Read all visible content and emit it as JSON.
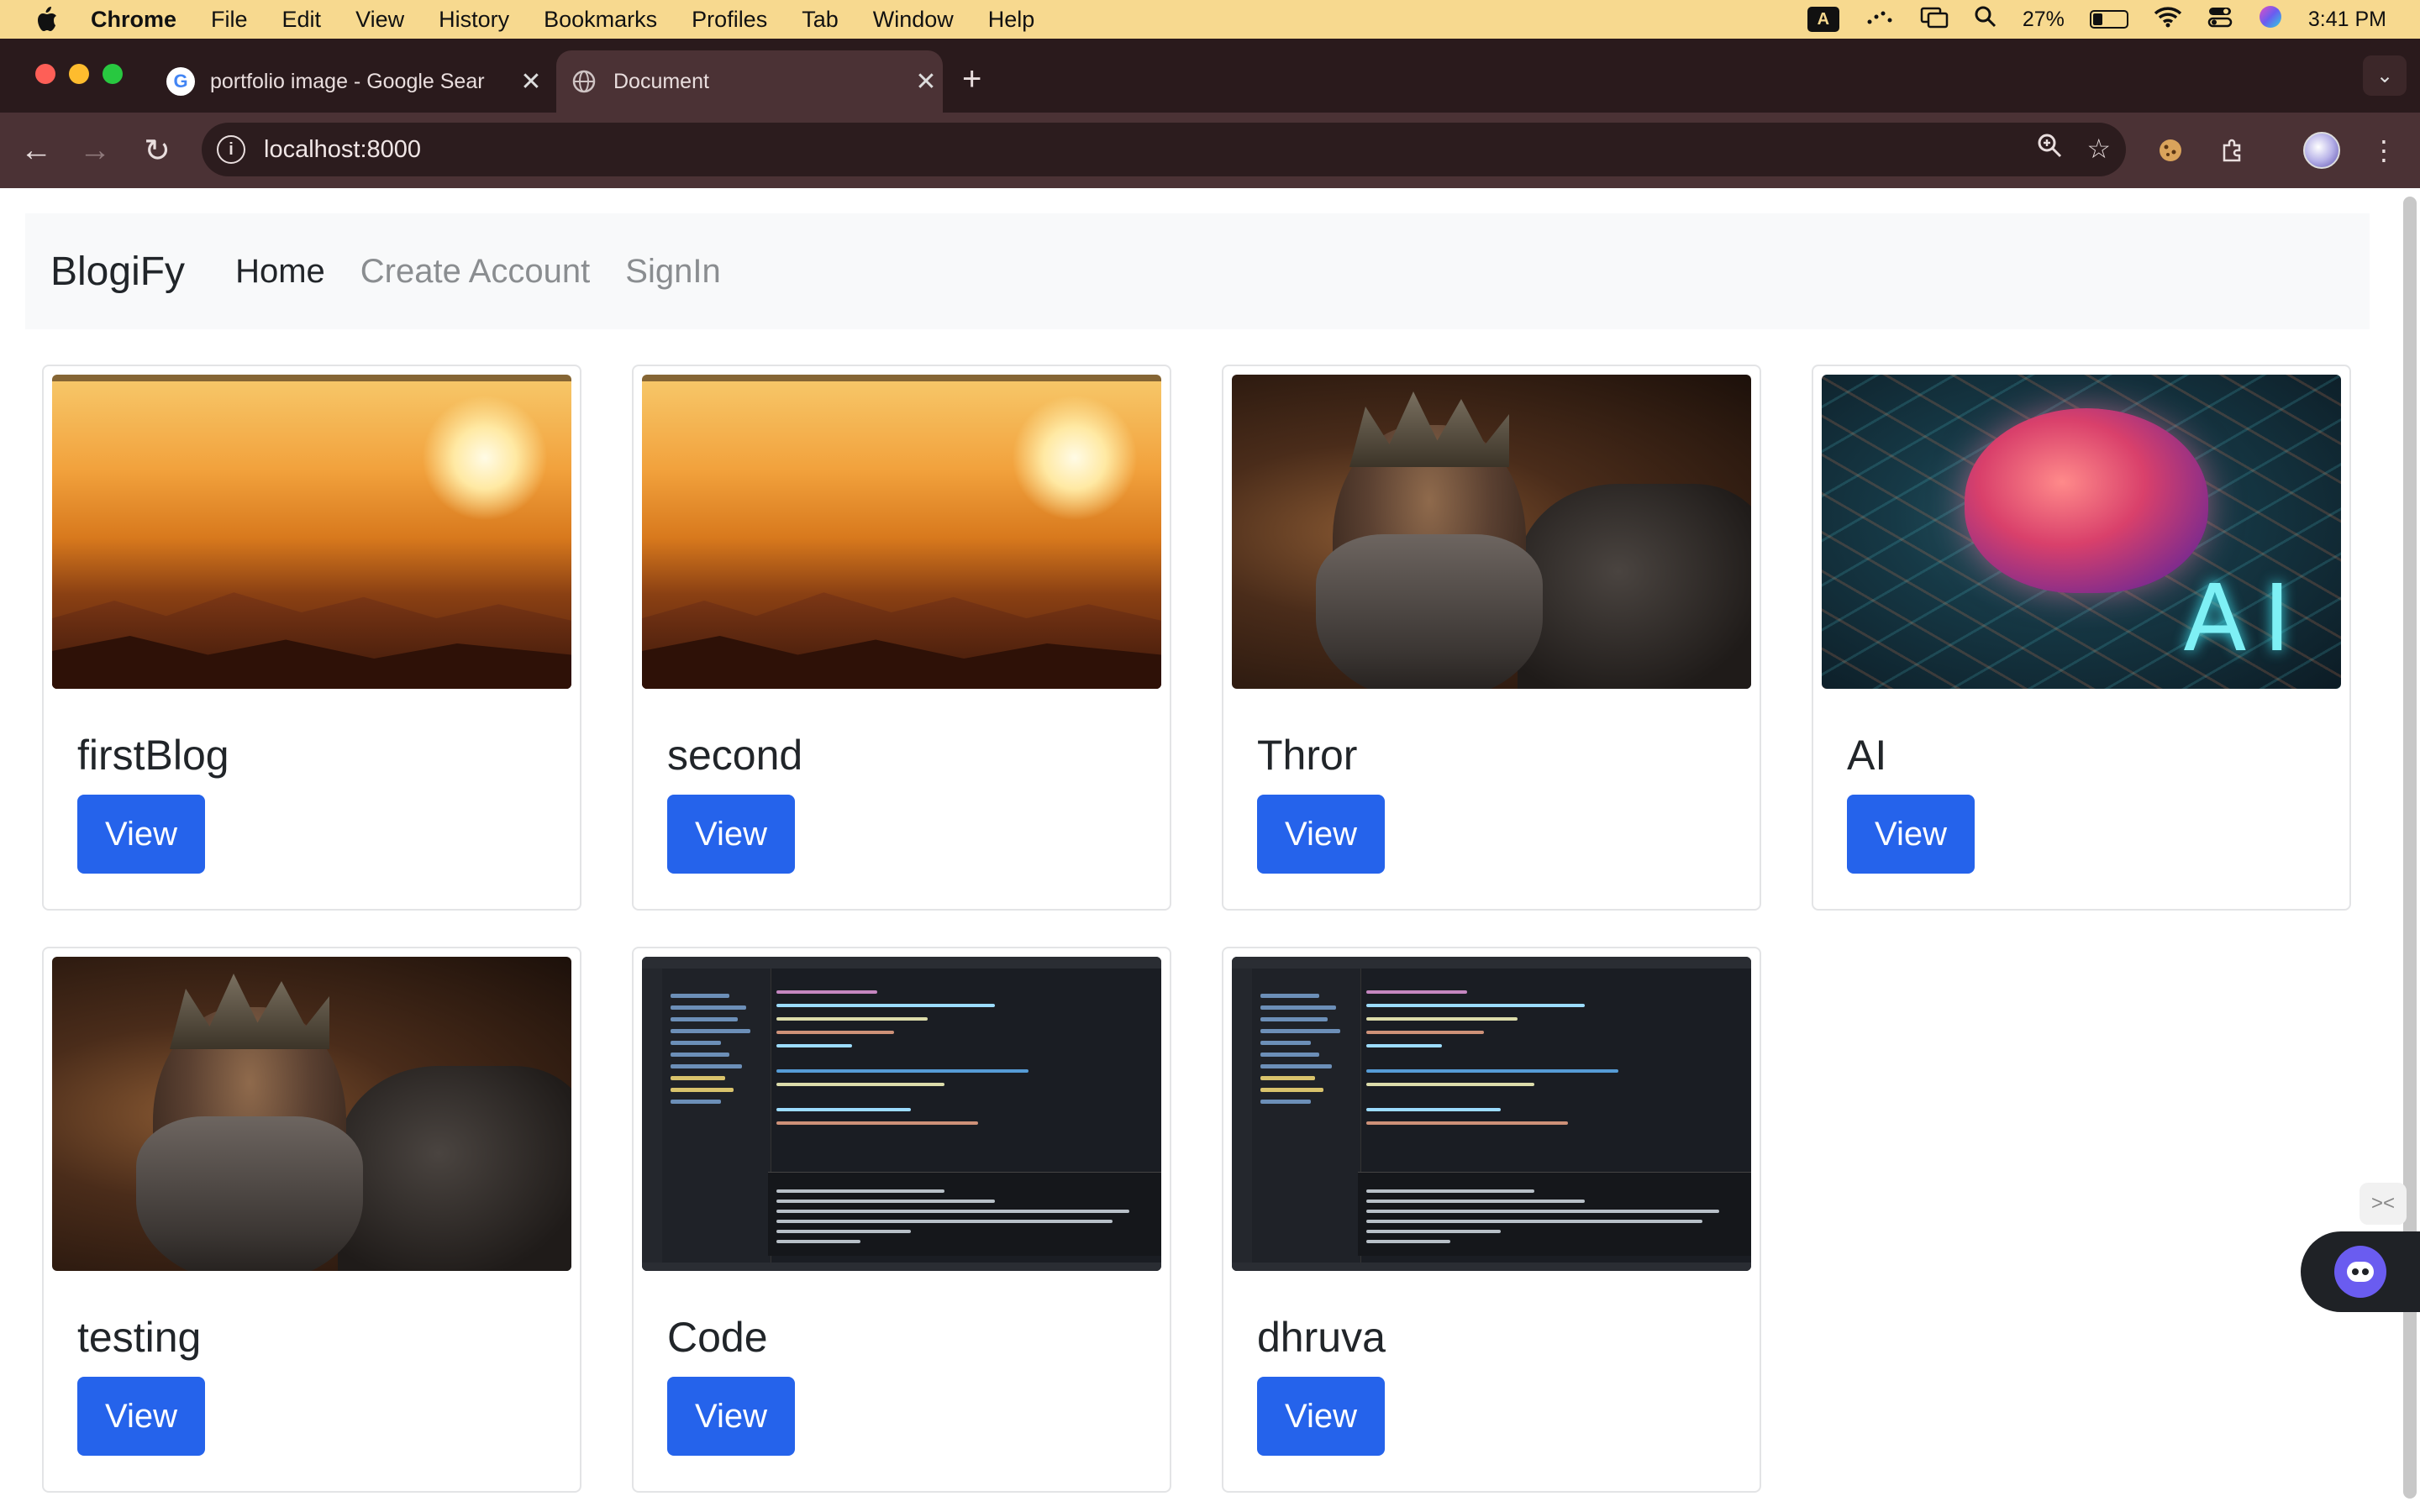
{
  "menubar": {
    "app_name": "Chrome",
    "items": [
      "File",
      "Edit",
      "View",
      "History",
      "Bookmarks",
      "Profiles",
      "Tab",
      "Window",
      "Help"
    ],
    "input_badge": "A",
    "battery_percent": "27%",
    "battery_level": 0.27,
    "clock": "3:41 PM"
  },
  "browser": {
    "tabs": [
      {
        "title": "portfolio image - Google Sear",
        "favicon": "google-icon",
        "active": false
      },
      {
        "title": "Document",
        "favicon": "globe-icon",
        "active": true
      }
    ],
    "url": "localhost:8000"
  },
  "site": {
    "brand": "BlogiFy",
    "nav": [
      {
        "label": "Home",
        "active": true
      },
      {
        "label": "Create Account",
        "active": false
      },
      {
        "label": "SignIn",
        "active": false
      }
    ]
  },
  "blogs": [
    {
      "title": "firstBlog",
      "button": "View",
      "image": "sunset-mountains"
    },
    {
      "title": "second",
      "button": "View",
      "image": "sunset-mountains"
    },
    {
      "title": "Thror",
      "button": "View",
      "image": "dwarf-portrait"
    },
    {
      "title": "AI",
      "button": "View",
      "image": "ai-brain",
      "image_text": "AI"
    },
    {
      "title": "testing",
      "button": "View",
      "image": "dwarf-portrait"
    },
    {
      "title": "Code",
      "button": "View",
      "image": "code-editor"
    },
    {
      "title": "dhruva",
      "button": "View",
      "image": "code-editor"
    }
  ],
  "colors": {
    "primary_button": "#2563eb",
    "navbar_bg": "#f8f9fa",
    "menubar_bg": "#f7d98f",
    "tabstrip_bg": "#2a1a1c",
    "toolbar_bg": "#4b3235"
  }
}
